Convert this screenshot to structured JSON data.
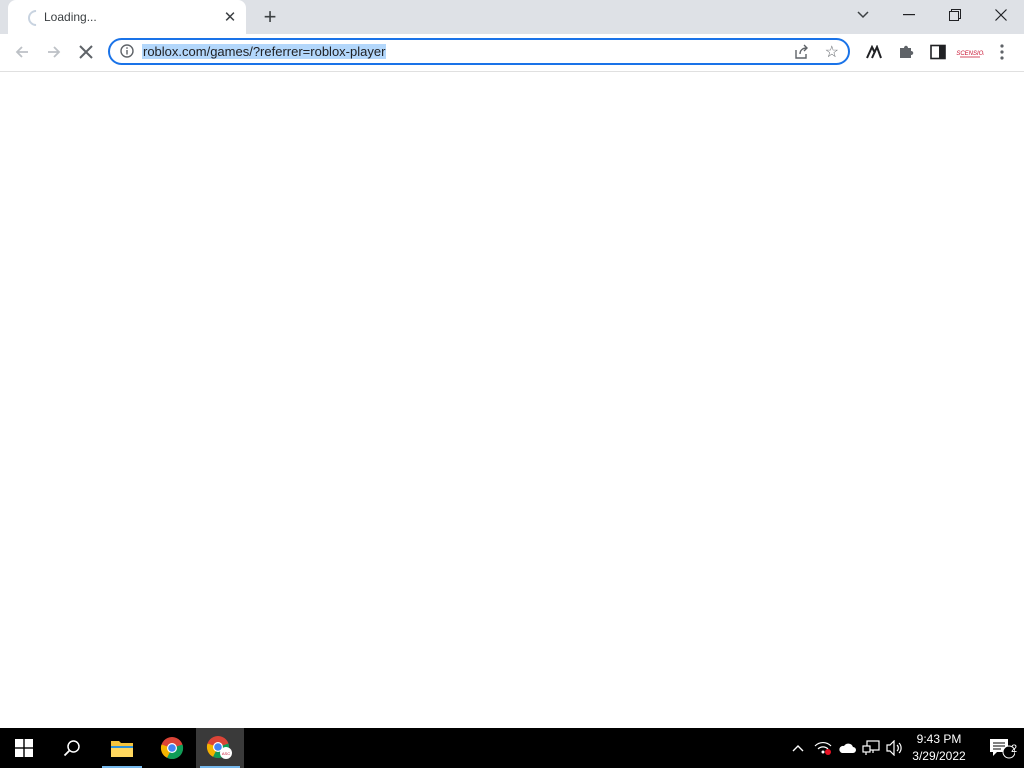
{
  "tab": {
    "title": "Loading..."
  },
  "omnibox": {
    "url": "roblox.com/games/?referrer=roblox-player"
  },
  "toolbar": {
    "profile_label": "ASCENSION"
  },
  "taskbar": {
    "time": "9:43 PM",
    "date": "3/29/2022",
    "notification_count": "2"
  },
  "colors": {
    "tabstrip": "#dee1e6",
    "omnibox_border": "#1a73e8",
    "url_selection": "#b3d7fb",
    "taskbar": "#000000",
    "taskbar_active_indicator": "#76b9ed"
  }
}
